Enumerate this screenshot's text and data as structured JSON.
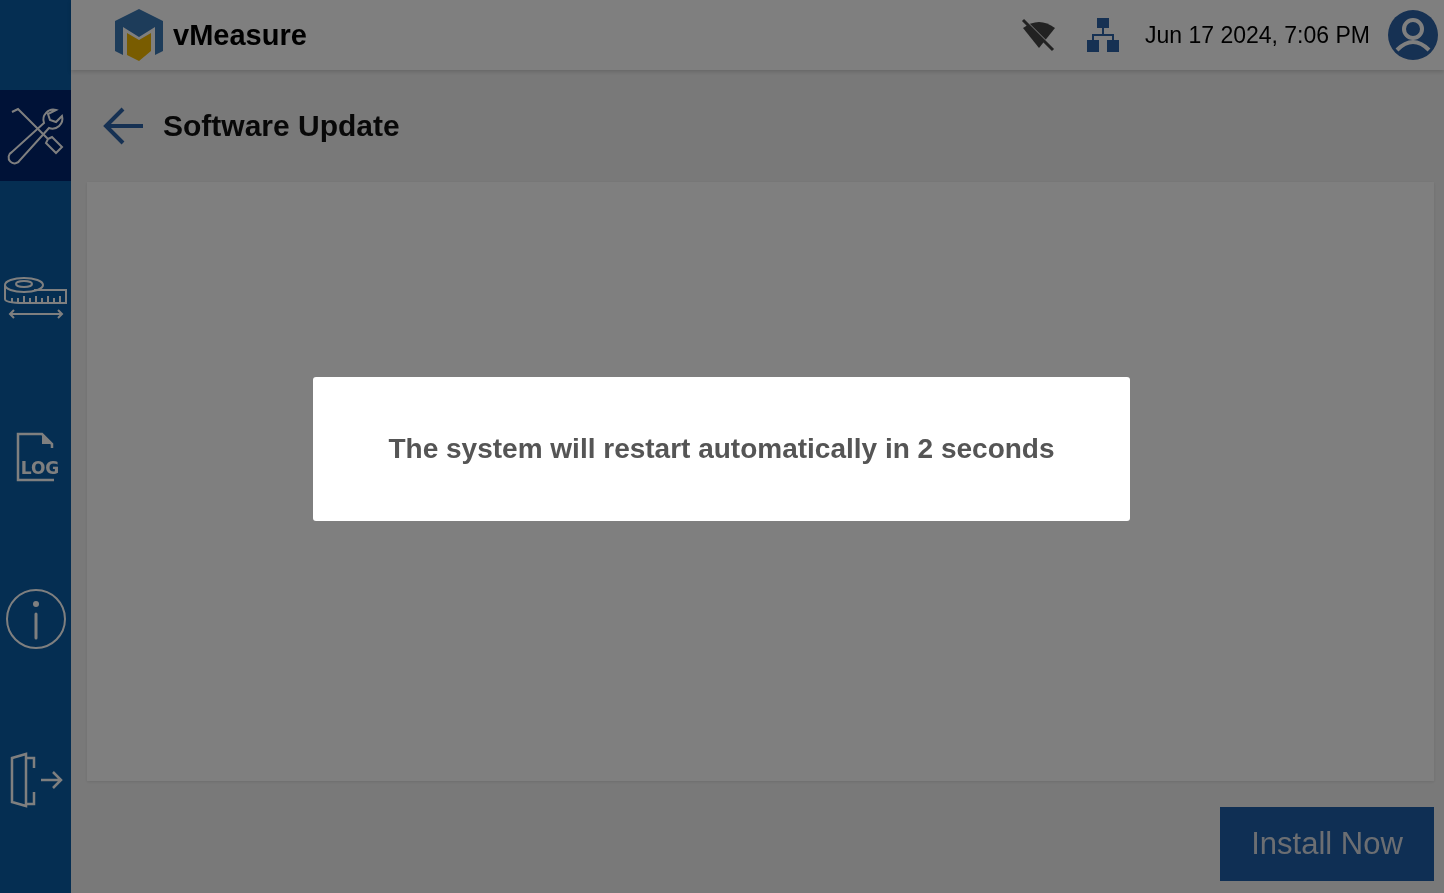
{
  "header": {
    "app_name": "vMeasure",
    "wifi_connected": false,
    "datetime": "Jun 17 2024, 7:06 PM"
  },
  "sidebar": {
    "items": [
      {
        "kind": "tools",
        "selected": true
      },
      {
        "kind": "tape",
        "selected": false
      },
      {
        "kind": "log",
        "selected": false,
        "label": "LOG"
      },
      {
        "kind": "info",
        "selected": false
      },
      {
        "kind": "exit",
        "selected": false
      }
    ]
  },
  "page": {
    "title": "Software Update"
  },
  "install_button": {
    "label": "Install Now"
  },
  "dialog": {
    "message": "The system will restart automatically in 2 seconds"
  }
}
